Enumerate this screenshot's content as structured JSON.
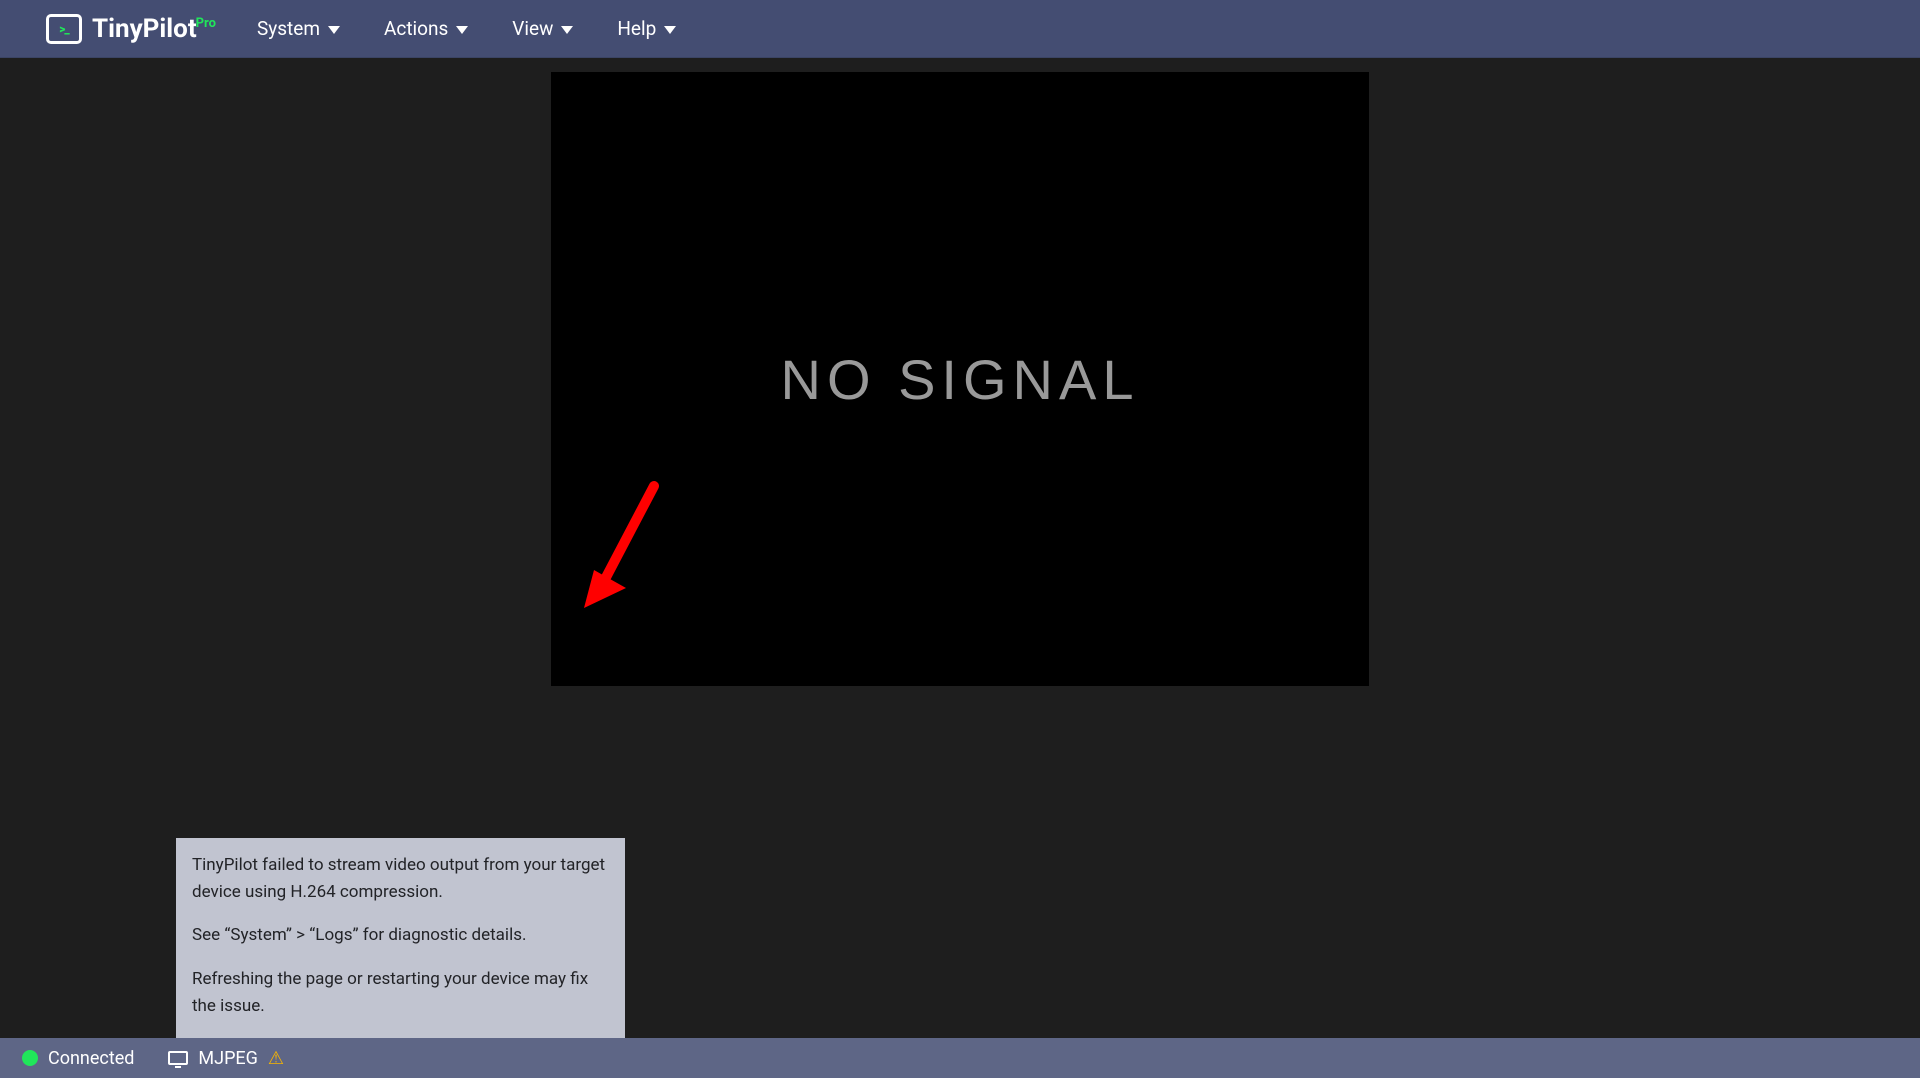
{
  "brand": {
    "name": "TinyPilot",
    "tier": "Pro",
    "glyph": ">_"
  },
  "menus": {
    "system": "System",
    "actions": "Actions",
    "view": "View",
    "help": "Help"
  },
  "screen": {
    "no_signal": "NO SIGNAL"
  },
  "tooltip": {
    "p1": "TinyPilot failed to stream video output from your target device using H.264 compression.",
    "p2": "See “System” > “Logs” for diagnostic details.",
    "p3": "Refreshing the page or restarting your device may fix the issue."
  },
  "status": {
    "connected": "Connected",
    "stream_mode": "MJPEG"
  }
}
